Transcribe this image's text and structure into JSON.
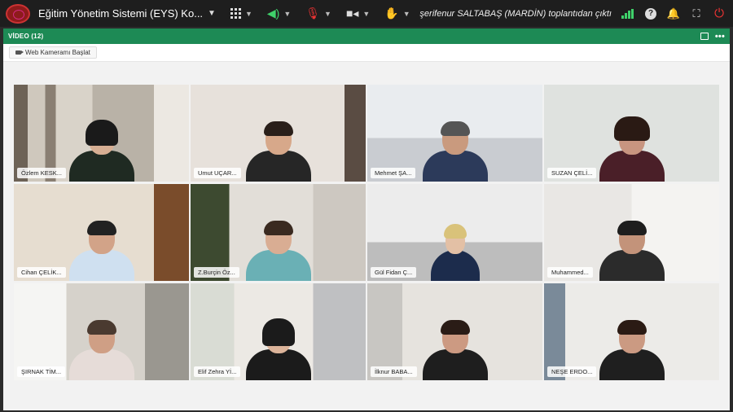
{
  "topbar": {
    "app_title": "Eğitim Yönetim Sistemi (EYS) Ko...",
    "status_message": "şerifenur SALTABAŞ (MARDİN) toplantıdan çıktı",
    "icons": [
      "app-logo",
      "grid-icon",
      "speaker-icon",
      "mic-off-icon",
      "camera-icon",
      "hand-icon",
      "signal-icon",
      "help-icon",
      "bell-icon",
      "fullscreen-icon",
      "power-icon"
    ],
    "colors": {
      "speaker": "#3fd16a",
      "mic_off": "#e33333",
      "power": "#e33333"
    }
  },
  "panel": {
    "title": "VİDEO (12)",
    "accent": "#1d8a55",
    "start_camera_label": "Web Kameramı Başlat"
  },
  "participants": [
    {
      "name": "Özlem KESK..."
    },
    {
      "name": "Umut UÇAR..."
    },
    {
      "name": "Mehmet ŞA..."
    },
    {
      "name": "SUZAN ÇELİ..."
    },
    {
      "name": "Cihan ÇELİK..."
    },
    {
      "name": "Z.Burçin Öz..."
    },
    {
      "name": "Gül Fidan Ç..."
    },
    {
      "name": "Muhammed..."
    },
    {
      "name": "ŞIRNAK TİM..."
    },
    {
      "name": "Elif Zehra Yİ..."
    },
    {
      "name": "İlknur BABA..."
    },
    {
      "name": "NEŞE ERDO..."
    }
  ]
}
